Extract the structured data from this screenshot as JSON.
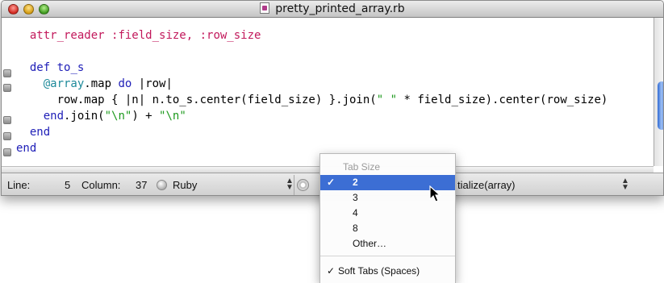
{
  "window": {
    "title": "pretty_printed_array.rb"
  },
  "editor": {
    "lines": [
      [
        {
          "t": "  "
        },
        {
          "t": "attr_reader",
          "c": "sym"
        },
        {
          "t": " "
        },
        {
          "t": ":field_size",
          "c": "sym"
        },
        {
          "t": ", ",
          "c": "sym"
        },
        {
          "t": ":row_size",
          "c": "sym"
        }
      ],
      [
        {
          "t": ""
        }
      ],
      [
        {
          "t": "  "
        },
        {
          "t": "def",
          "c": "k"
        },
        {
          "t": " "
        },
        {
          "t": "to_s",
          "c": "k"
        }
      ],
      [
        {
          "t": "    "
        },
        {
          "t": "@array",
          "c": "ivar"
        },
        {
          "t": ".map "
        },
        {
          "t": "do",
          "c": "k"
        },
        {
          "t": " |row|"
        }
      ],
      [
        {
          "t": "      row.map { |n| n.to_s.center(field_size) }.join("
        },
        {
          "t": "\" \"",
          "c": "str"
        },
        {
          "t": " * field_size).center(row_size)"
        }
      ],
      [
        {
          "t": "    "
        },
        {
          "t": "end",
          "c": "k"
        },
        {
          "t": ".join("
        },
        {
          "t": "\"\\n\"",
          "c": "str"
        },
        {
          "t": ") + "
        },
        {
          "t": "\"\\n\"",
          "c": "str"
        }
      ],
      [
        {
          "t": "  "
        },
        {
          "t": "end",
          "c": "k"
        }
      ],
      [
        {
          "t": "end",
          "c": "k"
        }
      ]
    ]
  },
  "status": {
    "line_label": "Line:",
    "line_value": "5",
    "column_label": "Column:",
    "column_value": "37",
    "language": "Ruby",
    "symbol": "tialize(array)"
  },
  "tab_menu": {
    "header": "Tab Size",
    "check_mark": "✓",
    "items": [
      "2",
      "3",
      "4",
      "8",
      "Other…"
    ],
    "selected_index": 0,
    "soft_tabs_label": "Soft Tabs (Spaces)",
    "soft_tabs_checked": true
  },
  "colors": {
    "selection": "#3c6ed4",
    "keyword": "#2020b8",
    "symbol": "#c2185b",
    "string": "#1e9a1e",
    "instance_var": "#1e8a9a"
  }
}
